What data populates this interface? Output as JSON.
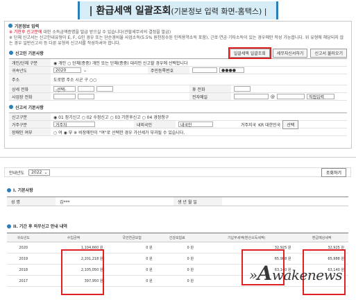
{
  "title": {
    "main": "| 환급세액 일괄조회",
    "sub": "(기본정보 입력 화면-홈택스) |"
  },
  "top": {
    "header": "기본정보 입력",
    "notice1_red": "※ 기한후 신고분에",
    "notice1": "대한 소득금액증명을 발급 받으실 수 있습니다(관할세무서의 결정을 발급)",
    "notice2": "※ 단체 신고서는 신고안내유형이 E, F, G인 경우 또는 단순경비율 사업소득(5.5% 원천징수된 인적용역소득 포함), 근로·연금·기타소득이 있는 경우에만 작성 가능합니다. 위 유형에 해당되지 않는 경우 일반신고서 등 다른 유형의 신고서를 작성하셔야 합니다.",
    "sec_title": "신고인 기본사항",
    "btn_bulk": "일괄세액 일괄조회",
    "btn_tax": "세무자신서하기",
    "btn_load": "신고서 불러오기",
    "rows": [
      {
        "label": "개인/단체 구분",
        "value": "◉ 개인  ○ 단체(종중)   개인 또는 단체(종중) 대리인 신고할 경우에 선택합니다"
      },
      {
        "label": "귀속년도",
        "value": "2020",
        "label2": "주민등록번호",
        "value2": "●●●●"
      },
      {
        "label": "주소",
        "value": "도로명 주소  시군 구 ○○"
      },
      {
        "label": "상세 전화",
        "value": "-선택-",
        "label2": "휴 전화"
      },
      {
        "label": "사업장 전화",
        "value": "",
        "label2": "전자메일",
        "value2": "직접입력"
      }
    ],
    "sec2_title": "신고서 기본사항",
    "rows2": [
      {
        "label": "신고구분",
        "value": "◉ 01 정기신고  ○ 02 수정신고  ○ 03 기한후신고  ○ 04 경정청구"
      },
      {
        "label": "거주구분",
        "value": "거주자",
        "label2": "내외국인",
        "value2": "내국인",
        "label3": "거주지국",
        "value3": "KR  대한민국",
        "btn": "선택"
      },
      {
        "label": "장애인 여부",
        "value": "○ 여  ◉ 부   ※ 비장애인이 \"여\"로 선택한 경우 가산세가 부과될 수 있습니다."
      }
    ]
  },
  "bottom": {
    "year_label": "안내년도",
    "year_value": "2022",
    "query_btn": "조회하기",
    "sec1": "I. 기본사항",
    "info": {
      "name_label": "성      명",
      "name_value": "김***",
      "id_label": "생 년 월 일"
    },
    "sec2": "II. 기간 후 의무신고 안내 내역",
    "columns": [
      "귀속년도",
      "수입금액",
      "국민연금보험",
      "건강보험료",
      "기납부세액(환산소득세액)",
      "환급예상세액"
    ],
    "rows": [
      [
        "2020",
        "1,104,660 원",
        "0 원",
        "0 원",
        "32,925 원",
        "32,925 원"
      ],
      [
        "2019",
        "2,201,218 원",
        "0 원",
        "0 원",
        "65,988 원",
        "65,988 원"
      ],
      [
        "2018",
        "2,105,050 원",
        "0 원",
        "0 원",
        "63,140 원",
        "63,140 원"
      ],
      [
        "2017",
        "397,950 원",
        "0 원",
        "0 원",
        "",
        ""
      ]
    ]
  },
  "watermark": {
    "lead": "»",
    "big": "A",
    "rest": "wakenews"
  }
}
